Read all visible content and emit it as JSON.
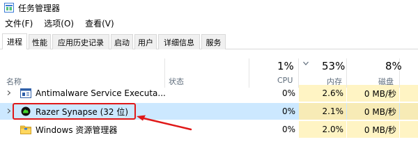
{
  "window": {
    "title": "任务管理器"
  },
  "menu": {
    "items": [
      "文件(F)",
      "选项(O)",
      "查看(V)"
    ]
  },
  "tabs": [
    "进程",
    "性能",
    "应用历史记录",
    "启动",
    "用户",
    "详细信息",
    "服务"
  ],
  "columns": {
    "name": "名称",
    "status": "状态",
    "cpu": {
      "pct": "1%",
      "label": "CPU"
    },
    "memory": {
      "pct": "53%",
      "label": "内存"
    },
    "disk": {
      "pct": "8%",
      "label": "磁盘"
    }
  },
  "rows": [
    {
      "name": "Antimalware Service Executa...",
      "cpu": "0%",
      "memory": "2.6%",
      "disk": "0 MB/秒",
      "icon": "service-icon",
      "expandable": true
    },
    {
      "name": "Razer Synapse (32 位)",
      "cpu": "0%",
      "memory": "2.1%",
      "disk": "0 MB/秒",
      "icon": "razer-icon",
      "expandable": true,
      "selected": true
    },
    {
      "name": "Windows 资源管理器",
      "cpu": "0%",
      "memory": "2.0%",
      "disk": "0 MB/秒",
      "icon": "folder-icon",
      "expandable": false
    }
  ],
  "colors": {
    "selection": "#cce8ff",
    "metric_bg": "#fff4c4",
    "highlight": "#e01818"
  }
}
